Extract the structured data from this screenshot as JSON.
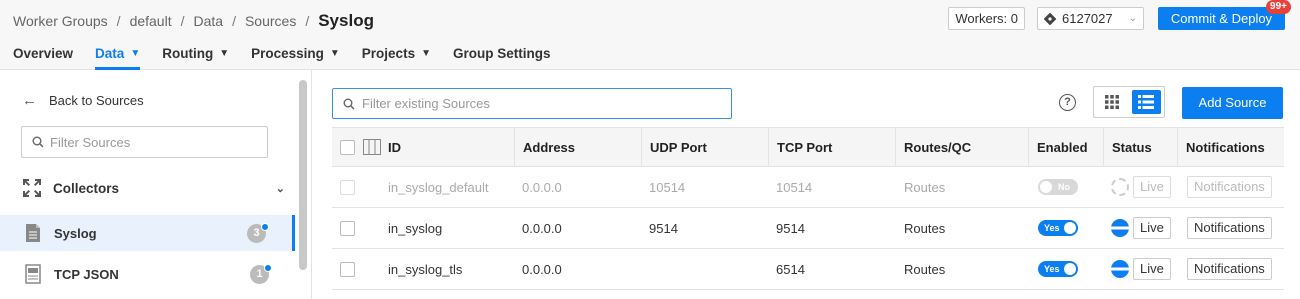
{
  "breadcrumb": [
    "Worker Groups",
    "default",
    "Data",
    "Sources"
  ],
  "breadcrumb_separator": "/",
  "page_title": "Syslog",
  "workers": "Workers: 0",
  "commit_id": "6127027",
  "commit_deploy": "Commit & Deploy",
  "notifications_badge": "99+",
  "nav": [
    {
      "label": "Overview"
    },
    {
      "label": "Data"
    },
    {
      "label": "Routing"
    },
    {
      "label": "Processing"
    },
    {
      "label": "Projects"
    },
    {
      "label": "Group Settings"
    }
  ],
  "sidebar": {
    "back": "Back to Sources",
    "search_placeholder": "Filter Sources",
    "collectors": "Collectors",
    "items": [
      {
        "label": "Syslog",
        "count": "3"
      },
      {
        "label": "TCP JSON",
        "count": "1"
      }
    ]
  },
  "main": {
    "search_placeholder": "Filter existing Sources",
    "help": "?",
    "add_source": "Add Source"
  },
  "table": {
    "headers": [
      "ID",
      "Address",
      "UDP Port",
      "TCP Port",
      "Routes/QC",
      "Enabled",
      "Status",
      "Notifications"
    ],
    "rows": [
      {
        "id": "in_syslog_default",
        "address": "0.0.0.0",
        "udp": "10514",
        "tcp": "10514",
        "routes": "Routes",
        "enabled": "No",
        "status": "Live",
        "notifications": "Notifications"
      },
      {
        "id": "in_syslog",
        "address": "0.0.0.0",
        "udp": "9514",
        "tcp": "9514",
        "routes": "Routes",
        "enabled": "Yes",
        "status": "Live",
        "notifications": "Notifications"
      },
      {
        "id": "in_syslog_tls",
        "address": "0.0.0.0",
        "udp": "",
        "tcp": "6514",
        "routes": "Routes",
        "enabled": "Yes",
        "status": "Live",
        "notifications": "Notifications"
      }
    ]
  },
  "colors": {
    "accent": "#0b7ef0",
    "badge": "#e8413a"
  },
  "icons": [
    "search-icon",
    "back-arrow-icon",
    "collectors-icon",
    "file-icon",
    "help-icon",
    "grid-view-icon",
    "list-view-icon",
    "git-commit-icon",
    "chevron-down-icon",
    "columns-icon"
  ]
}
